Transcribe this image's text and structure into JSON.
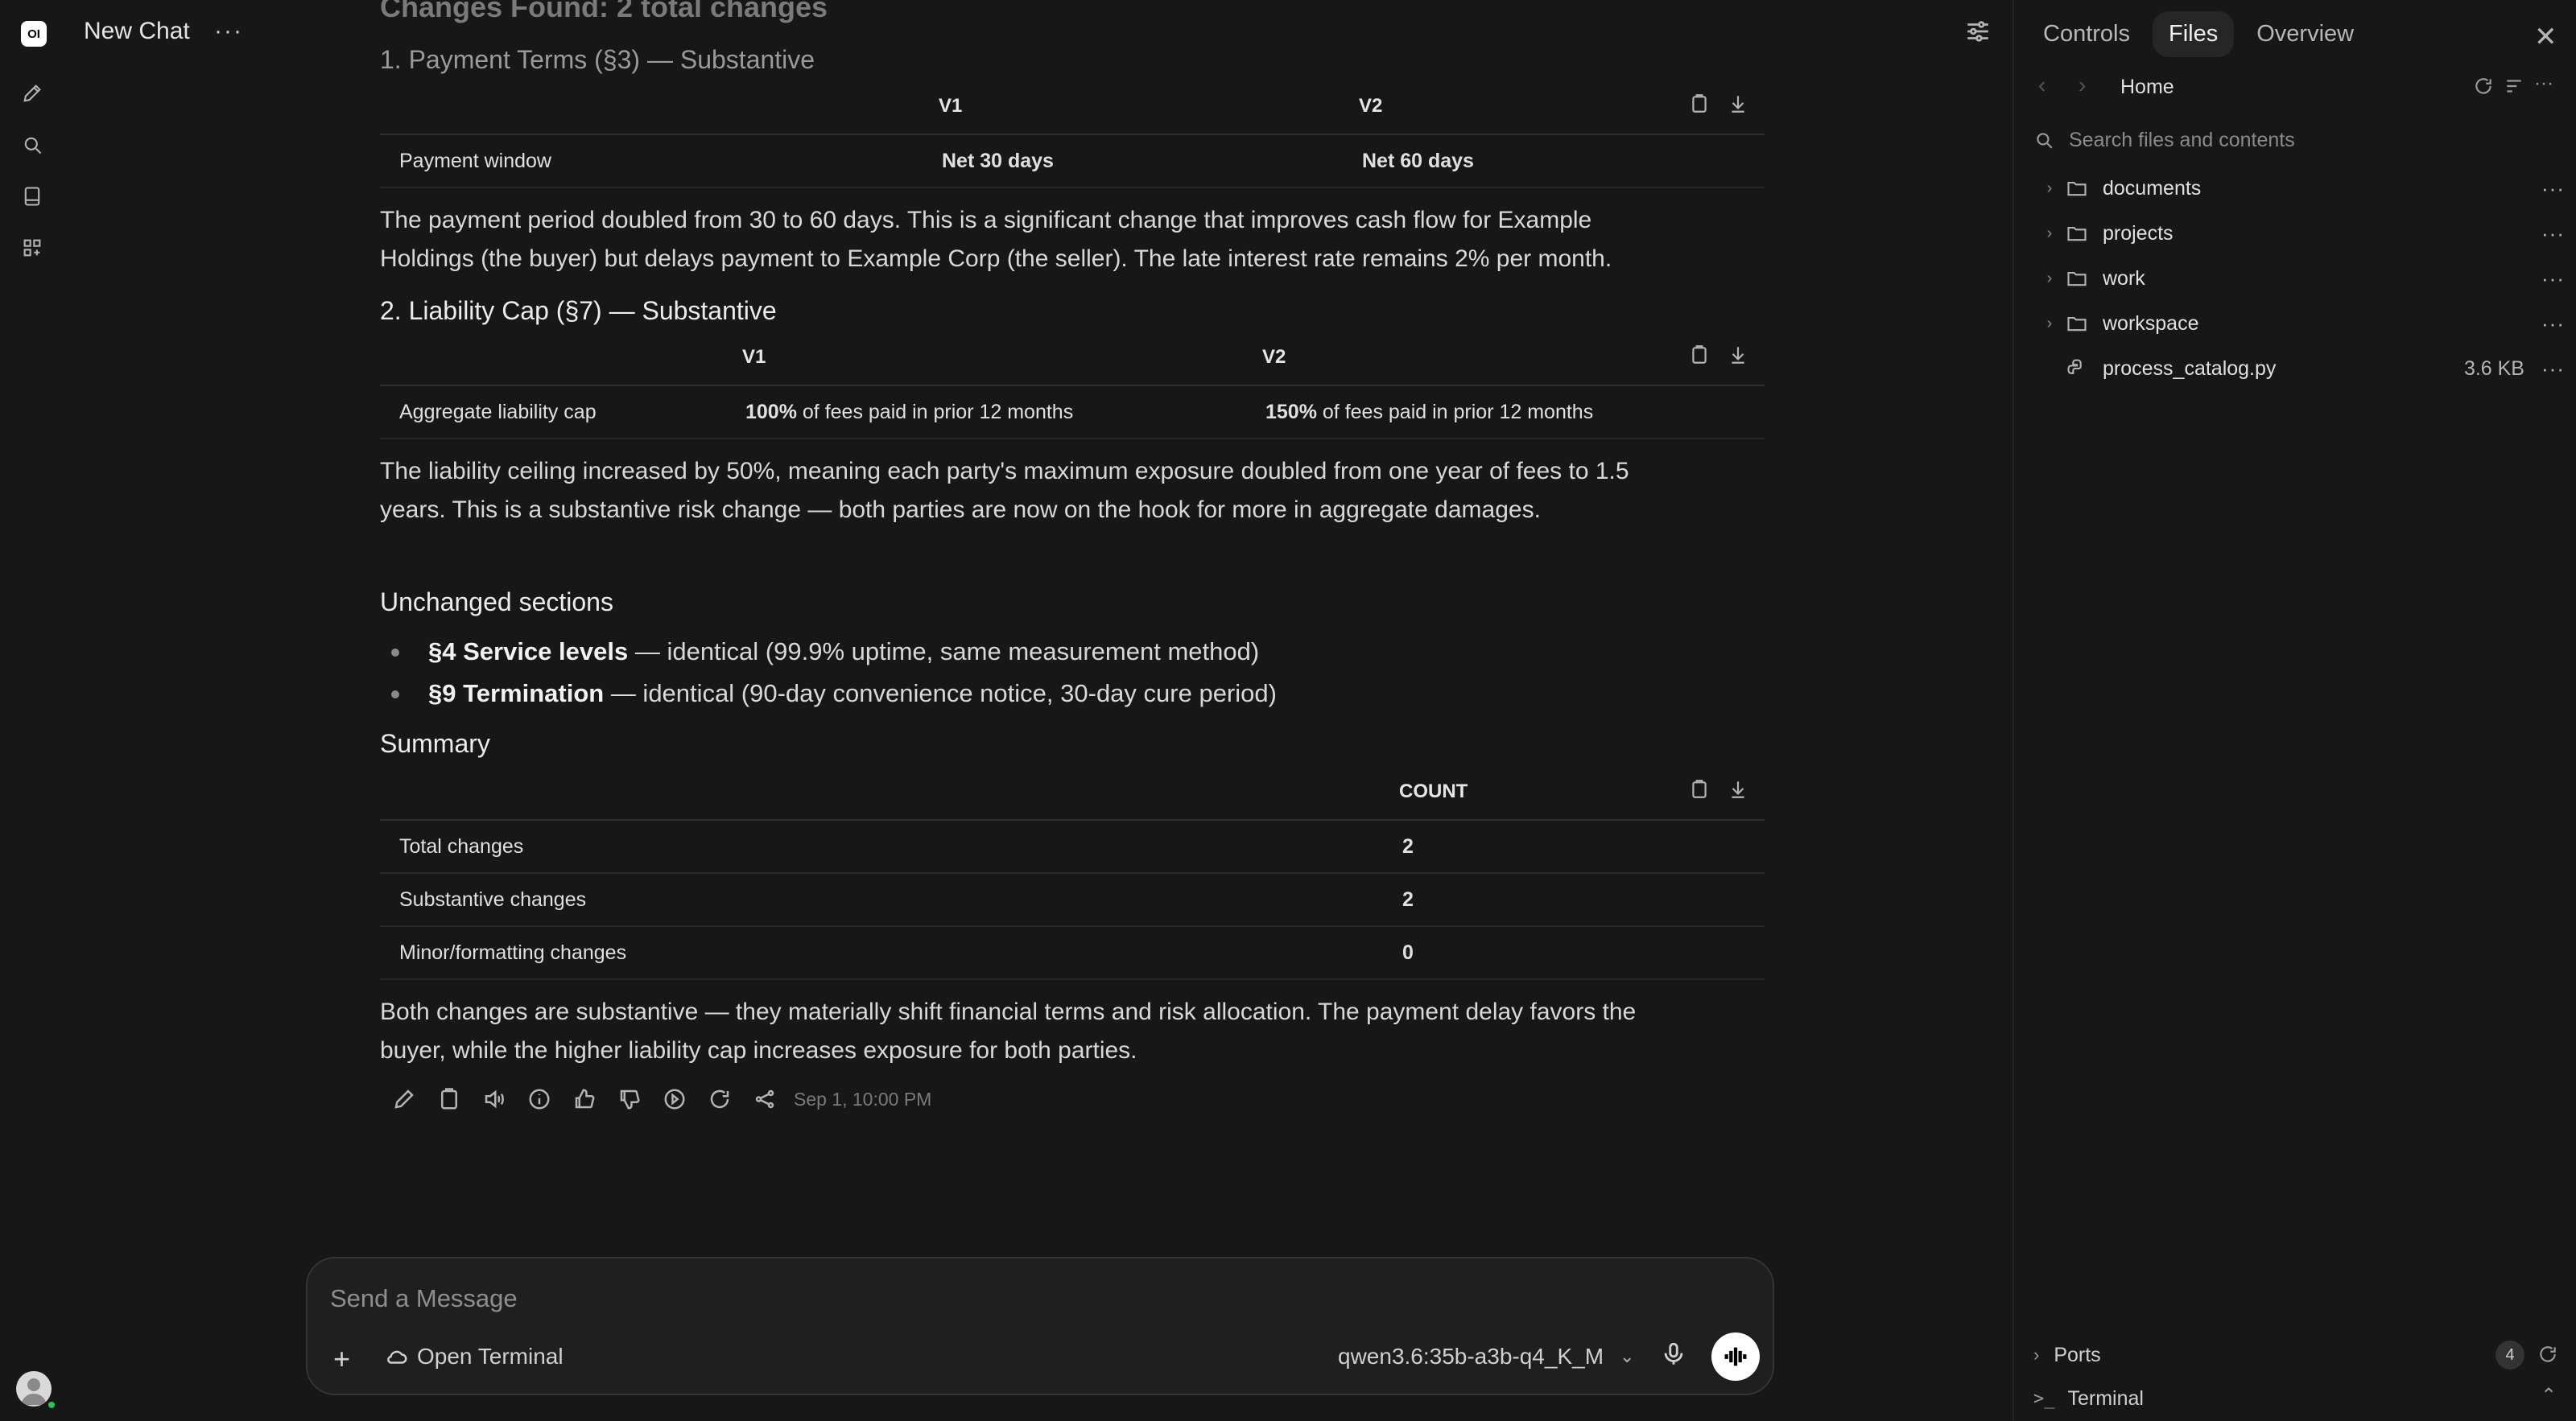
{
  "app": {
    "logo_text": "OI",
    "chat_title": "New Chat",
    "chat_menu": "···"
  },
  "message": {
    "faded_heading": "Changes Found: 2 total changes",
    "section1_heading": "1. Payment Terms (§3) — Substantive",
    "table1": {
      "headers": [
        "",
        "V1",
        "V2"
      ],
      "rows": [
        {
          "label": "Payment window",
          "v1": "Net 30 days",
          "v2": "Net 60 days"
        }
      ]
    },
    "para1_line1": "The payment period doubled from 30 to 60 days. This is a significant change that improves cash flow for Example",
    "para1_line2": "Holdings (the buyer) but delays payment to Example Corp (the seller). The late interest rate remains 2% per month.",
    "section2_heading": "2. Liability Cap (§7) — Substantive",
    "table2": {
      "headers": [
        "",
        "V1",
        "V2"
      ],
      "rows": [
        {
          "label": "Aggregate liability cap",
          "v1_bold": "100%",
          "v1_rest": " of fees paid in prior 12 months",
          "v2_bold": "150%",
          "v2_rest": " of fees paid in prior 12 months"
        }
      ]
    },
    "para2_line1": "The liability ceiling increased by 50%, meaning each party's maximum exposure doubled from one year of fees to 1.5",
    "para2_line2": "years. This is a substantive risk change — both parties are now on the hook for more in aggregate damages.",
    "unchanged_heading": "Unchanged sections",
    "unchanged": [
      {
        "bold": "§4 Service levels",
        "rest": " — identical (99.9% uptime, same measurement method)"
      },
      {
        "bold": "§9 Termination",
        "rest": " — identical (90-day convenience notice, 30-day cure period)"
      }
    ],
    "summary_heading": "Summary",
    "summary_table": {
      "headers": [
        "",
        "COUNT"
      ],
      "rows": [
        {
          "label": "Total changes",
          "count": "2"
        },
        {
          "label": "Substantive changes",
          "count": "2"
        },
        {
          "label": "Minor/formatting changes",
          "count": "0"
        }
      ]
    },
    "para3_line1": "Both changes are substantive — they materially shift financial terms and risk allocation. The payment delay favors the",
    "para3_line2": "buyer, while the higher liability cap increases exposure for both parties.",
    "timestamp": "Sep 1, 10:00 PM"
  },
  "composer": {
    "placeholder": "Send a Message",
    "open_terminal": "Open Terminal",
    "model": "qwen3.6:35b-a3b-q4_K_M"
  },
  "panel": {
    "tabs": [
      "Controls",
      "Files",
      "Overview"
    ],
    "active_tab": "Files",
    "breadcrumb": "Home",
    "search_placeholder": "Search files and contents",
    "items": [
      {
        "name": "documents",
        "type": "folder"
      },
      {
        "name": "projects",
        "type": "folder"
      },
      {
        "name": "work",
        "type": "folder"
      },
      {
        "name": "workspace",
        "type": "folder"
      },
      {
        "name": "process_catalog.py",
        "type": "file",
        "size": "3.6 KB"
      }
    ],
    "ports_label": "Ports",
    "ports_count": "4",
    "terminal_label": "Terminal"
  }
}
